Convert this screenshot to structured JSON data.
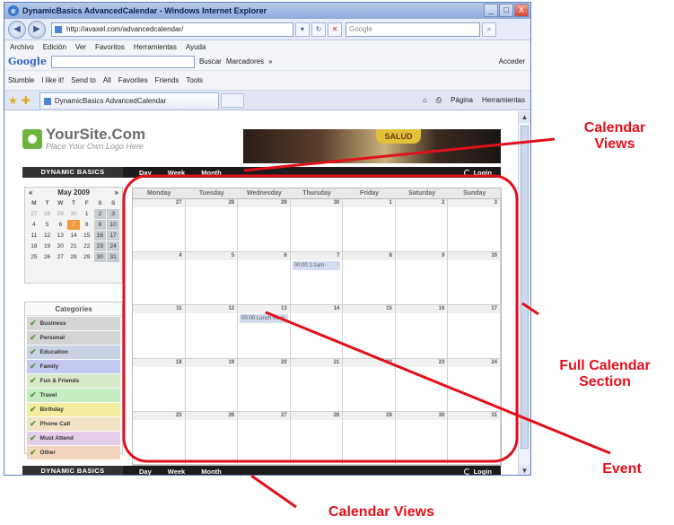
{
  "window": {
    "title": "DynamicBasics AdvancedCalendar - Windows Internet Explorer",
    "min": "_",
    "max": "□",
    "close": "X"
  },
  "address": {
    "url": "http://avaxel.com/advancedcalendar/",
    "search_placeholder": "Google"
  },
  "menu": [
    "Archivo",
    "Edición",
    "Ver",
    "Favoritos",
    "Herramientas",
    "Ayuda"
  ],
  "google_toolbar": {
    "logo": "Google",
    "buscar": "Buscar",
    "marcadores": "Marcadores",
    "more": "»",
    "acceder": "Acceder"
  },
  "stumble_toolbar": {
    "stumble": "Stumble",
    "like": "I like it!",
    "send": "Send to",
    "all": "All",
    "favorites": "Favorites",
    "friends": "Friends",
    "tools": "Tools"
  },
  "tab": {
    "label": "DynamicBasics AdvancedCalendar",
    "pagina": "Página",
    "herramientas": "Herramientas"
  },
  "site": {
    "name": "YourSite.Com",
    "tagline": "Place Your Own Logo Here",
    "photo_text": "SALUD"
  },
  "nav": {
    "brand": "DYNAMIC BASICS",
    "day": "Day",
    "week": "Week",
    "month": "Month",
    "login": "Login"
  },
  "mini_calendar": {
    "month": "May 2009",
    "prev": "«",
    "next": "»",
    "dow": [
      "M",
      "T",
      "W",
      "T",
      "F",
      "S",
      "S"
    ],
    "weeks": [
      [
        "27",
        "28",
        "29",
        "30",
        "1",
        "2",
        "3"
      ],
      [
        "4",
        "5",
        "6",
        "7",
        "8",
        "9",
        "10"
      ],
      [
        "11",
        "12",
        "13",
        "14",
        "15",
        "16",
        "17"
      ],
      [
        "18",
        "19",
        "20",
        "21",
        "22",
        "23",
        "24"
      ],
      [
        "25",
        "26",
        "27",
        "28",
        "29",
        "30",
        "31"
      ]
    ],
    "today": "7"
  },
  "categories": {
    "title": "Categories",
    "items": [
      {
        "label": "Business",
        "color": "#d4d4d4"
      },
      {
        "label": "Personal",
        "color": "#d4d4d4"
      },
      {
        "label": "Education",
        "color": "#c9d3e4"
      },
      {
        "label": "Family",
        "color": "#c3c8f0"
      },
      {
        "label": "Fun & Friends",
        "color": "#d7e9c8"
      },
      {
        "label": "Travel",
        "color": "#c6ecc2"
      },
      {
        "label": "Birthday",
        "color": "#f4ec9e"
      },
      {
        "label": "Phone Call",
        "color": "#f3e3c5"
      },
      {
        "label": "Must Attend",
        "color": "#e6cdea"
      },
      {
        "label": "Other",
        "color": "#f6d5be"
      }
    ]
  },
  "calendar": {
    "dow": [
      "Monday",
      "Tuesday",
      "Wednesday",
      "Thursday",
      "Friday",
      "Saturday",
      "Sunday"
    ],
    "weeks": [
      [
        "27",
        "28",
        "29",
        "30",
        "1",
        "2",
        "3"
      ],
      [
        "4",
        "5",
        "6",
        "7",
        "8",
        "9",
        "10"
      ],
      [
        "11",
        "12",
        "13",
        "14",
        "15",
        "16",
        "17"
      ],
      [
        "18",
        "19",
        "20",
        "21",
        "22",
        "23",
        "24"
      ],
      [
        "25",
        "26",
        "27",
        "28",
        "29",
        "30",
        "31"
      ]
    ],
    "events": [
      {
        "week": 1,
        "day": 3,
        "text": "00:00 1:1am"
      },
      {
        "week": 2,
        "day": 2,
        "text": "00:00 Lunch meet"
      }
    ]
  },
  "annotations": {
    "calendar_views_top": "Calendar\nViews",
    "full_calendar": "Full Calendar\nSection",
    "event": "Event",
    "calendar_views_bottom": "Calendar Views",
    "color": "#e3101b"
  }
}
